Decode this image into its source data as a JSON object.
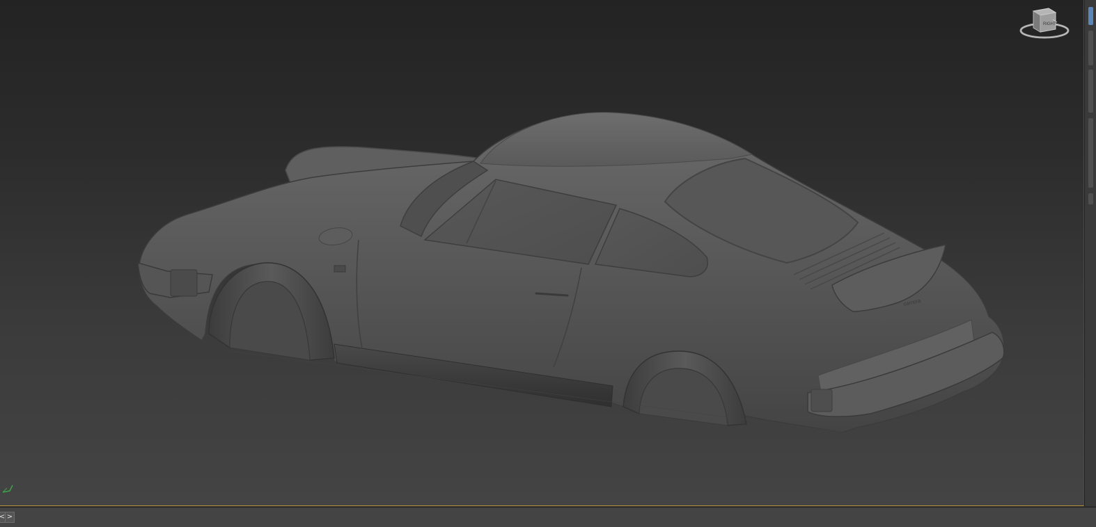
{
  "viewport": {
    "view_mode": "Perspective",
    "background_top": "#232323",
    "background_bottom": "#444444",
    "border_accent": "#b8953c"
  },
  "viewcube": {
    "face_label": "RIGHT",
    "icon": "viewcube-icon"
  },
  "model": {
    "name": "car-coupe-model",
    "badge_text": "carrera"
  },
  "axis_gizmo": {
    "icon": "axis-tripod-icon",
    "color": "#3fa34d"
  },
  "bottom_bar": {
    "prev_label": "<",
    "next_label": ">"
  }
}
